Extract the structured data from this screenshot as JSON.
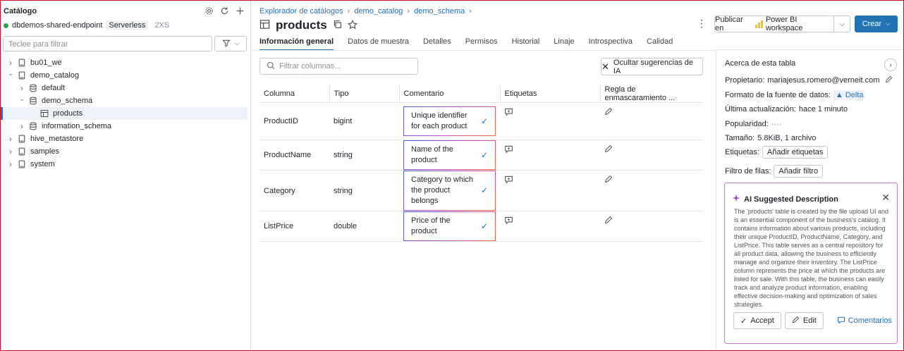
{
  "sidebar": {
    "title": "Catálogo",
    "endpoint": "dbdemos-shared-endpoint",
    "endpoint_tag": "Serverless",
    "endpoint_size": "2XS",
    "filter_placeholder": "Teclee para filtrar",
    "icons": [
      "gear-icon",
      "refresh-icon",
      "plus-icon"
    ],
    "tree": [
      {
        "label": "bu01_we",
        "level": 0,
        "icon": "catalog-icon",
        "expanded": false
      },
      {
        "label": "demo_catalog",
        "level": 0,
        "icon": "catalog-icon",
        "expanded": true
      },
      {
        "label": "default",
        "level": 1,
        "icon": "schema-icon",
        "expanded": false
      },
      {
        "label": "demo_schema",
        "level": 1,
        "icon": "schema-icon",
        "expanded": true
      },
      {
        "label": "products",
        "level": 2,
        "icon": "table-icon",
        "selected": true
      },
      {
        "label": "information_schema",
        "level": 1,
        "icon": "schema-icon",
        "expanded": false
      },
      {
        "label": "hive_metastore",
        "level": 0,
        "icon": "catalog-icon",
        "expanded": false
      },
      {
        "label": "samples",
        "level": 0,
        "icon": "catalog-icon",
        "expanded": false
      },
      {
        "label": "system",
        "level": 0,
        "icon": "catalog-icon",
        "expanded": false
      }
    ]
  },
  "main": {
    "breadcrumb": [
      "Explorador de catálogos",
      "demo_catalog",
      "demo_schema"
    ],
    "title": "products",
    "tabs": [
      "Información general",
      "Datos de muestra",
      "Detalles",
      "Permisos",
      "Historial",
      "Linaje",
      "Introspectiva",
      "Calidad"
    ],
    "active_tab": 0,
    "search_placeholder": "Filtrar columnas...",
    "hide_ai_label": "Ocultar sugerencias de IA",
    "columns_header": [
      "Columna",
      "Tipo",
      "Comentario",
      "Etiquetas",
      "Regla de enmascaramiento ..."
    ],
    "rows": [
      {
        "name": "ProductID",
        "type": "bigint",
        "comment": "Unique identifier for each product"
      },
      {
        "name": "ProductName",
        "type": "string",
        "comment": "Name of the product"
      },
      {
        "name": "Category",
        "type": "string",
        "comment": "Category to which the product belongs"
      },
      {
        "name": "ListPrice",
        "type": "double",
        "comment": "Price of the product"
      }
    ]
  },
  "header_actions": {
    "publish_label": "Publicar en",
    "publish_target": "Power BI workspace",
    "create_label": "Crear"
  },
  "about": {
    "title": "Acerca de esta tabla",
    "owner_label": "Propietario:",
    "owner_value": "mariajesus.romero@verneit.com",
    "format_label": "Formato de la fuente de datos:",
    "format_value": "Delta",
    "updated_label": "Última actualización:",
    "updated_value": "hace 1 minuto",
    "popularity_label": "Popularidad:",
    "size_label": "Tamaño:",
    "size_value": "5.8KiB, 1 archivo",
    "tags_label": "Etiquetas:",
    "tags_button": "Añadir etiquetas",
    "row_filter_label": "Filtro de filas:",
    "row_filter_button": "Añadir filtro"
  },
  "ai_card": {
    "title": "AI Suggested Description",
    "text": "The 'products' table is created by the file upload UI and is an essential component of the business's catalog. It contains information about various products, including their unique ProductID, ProductName, Category, and ListPrice. This table serves as a central repository for all product data, allowing the business to efficiently manage and organize their inventory. The ListPrice column represents the price at which the products are listed for sale. With this table, the business can easily track and analyze product information, enabling effective decision-making and optimization of sales strategies.",
    "accept_label": "Accept",
    "edit_label": "Edit",
    "comments_label": "Comentarios"
  },
  "colors": {
    "accent": "#2272b4",
    "status_green": "#2ca54e",
    "border": "#c4c7cc"
  }
}
